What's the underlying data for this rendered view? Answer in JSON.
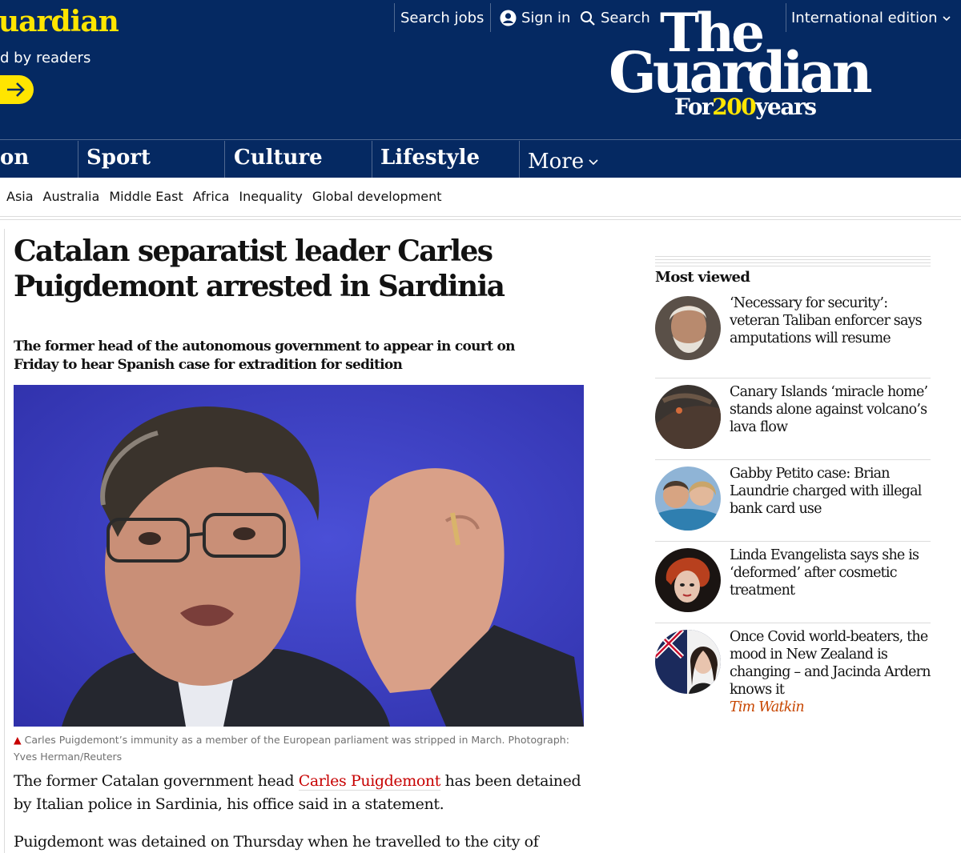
{
  "masthead": {
    "support_title": "uardian",
    "support_subtitle": "d by readers",
    "top_links": {
      "search_jobs": "Search jobs",
      "sign_in": "Sign in",
      "search": "Search",
      "edition": "International edition"
    },
    "logo": {
      "the": "The",
      "guardian": "Guardian",
      "for": "For",
      "number": "200",
      "years": "years"
    },
    "colors": {
      "background": "#052962",
      "accent": "#ffe500"
    }
  },
  "nav": {
    "items": [
      "on",
      "Sport",
      "Culture",
      "Lifestyle"
    ],
    "more": "More"
  },
  "subnav": {
    "items": [
      "Asia",
      "Australia",
      "Middle East",
      "Africa",
      "Inequality",
      "Global development"
    ]
  },
  "article": {
    "headline": "Catalan separatist leader Carles Puigdemont arrested in Sardinia",
    "standfirst": "The former head of the autonomous government to appear in court on Friday to hear Spanish case for extradition for sedition",
    "caption": "Carles Puigdemont’s immunity as a member of the European parliament was stripped in March. Photograph: Yves Herman/Reuters",
    "paragraph1": {
      "before": "The former Catalan government head ",
      "link": "Carles Puigdemont",
      "after": " has been detained by Italian police in Sardinia, his office said in a statement."
    },
    "paragraph2": "Puigdemont was detained on Thursday when he travelled to the city of"
  },
  "most_viewed": {
    "title": "Most viewed",
    "items": [
      {
        "headline": "‘Necessary for security’: veteran Taliban enforcer says amputations will resume",
        "byline": ""
      },
      {
        "headline": "Canary Islands ‘miracle home’ stands alone against volcano’s lava flow",
        "byline": ""
      },
      {
        "headline": "Gabby Petito case: Brian Laundrie charged with illegal bank card use",
        "byline": ""
      },
      {
        "headline": "Linda Evangelista says she is ‘deformed’ after cosmetic treatment",
        "byline": ""
      },
      {
        "headline": "Once Covid world-beaters, the mood in New Zealand is changing – and Jacinda Ardern knows it",
        "byline": "Tim Watkin"
      }
    ]
  }
}
